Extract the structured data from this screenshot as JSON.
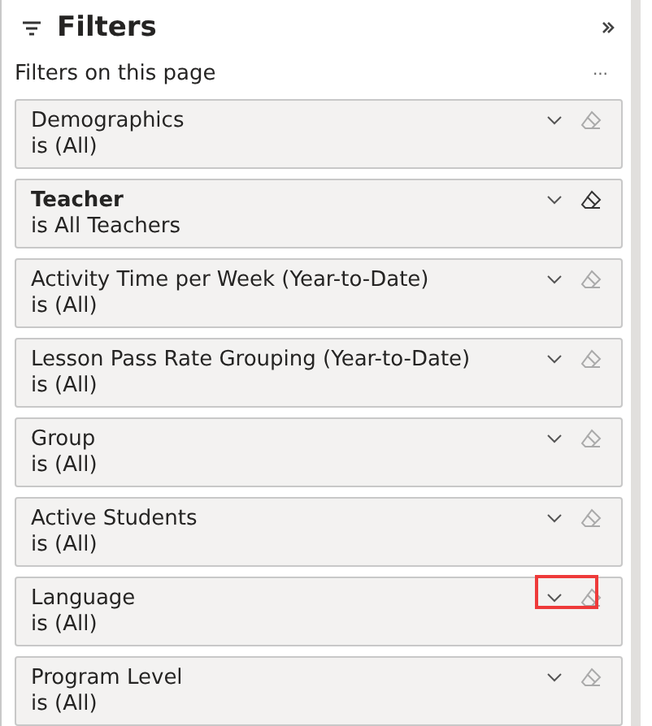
{
  "header": {
    "title": "Filters"
  },
  "section": {
    "label": "Filters on this page",
    "more": "..."
  },
  "filters": [
    {
      "name": "Demographics",
      "condition": "is (All)",
      "active": false,
      "highlighted": false
    },
    {
      "name": "Teacher",
      "condition": "is All Teachers",
      "active": true,
      "highlighted": false
    },
    {
      "name": "Activity Time per Week (Year-to-Date)",
      "condition": "is (All)",
      "active": false,
      "highlighted": false
    },
    {
      "name": "Lesson Pass Rate Grouping (Year-to-Date)",
      "condition": "is (All)",
      "active": false,
      "highlighted": false
    },
    {
      "name": "Group",
      "condition": "is (All)",
      "active": false,
      "highlighted": false
    },
    {
      "name": "Active Students",
      "condition": "is (All)",
      "active": false,
      "highlighted": false
    },
    {
      "name": "Language",
      "condition": "is (All)",
      "active": false,
      "highlighted": true
    },
    {
      "name": "Program Level",
      "condition": "is (All)",
      "active": false,
      "highlighted": false
    }
  ]
}
